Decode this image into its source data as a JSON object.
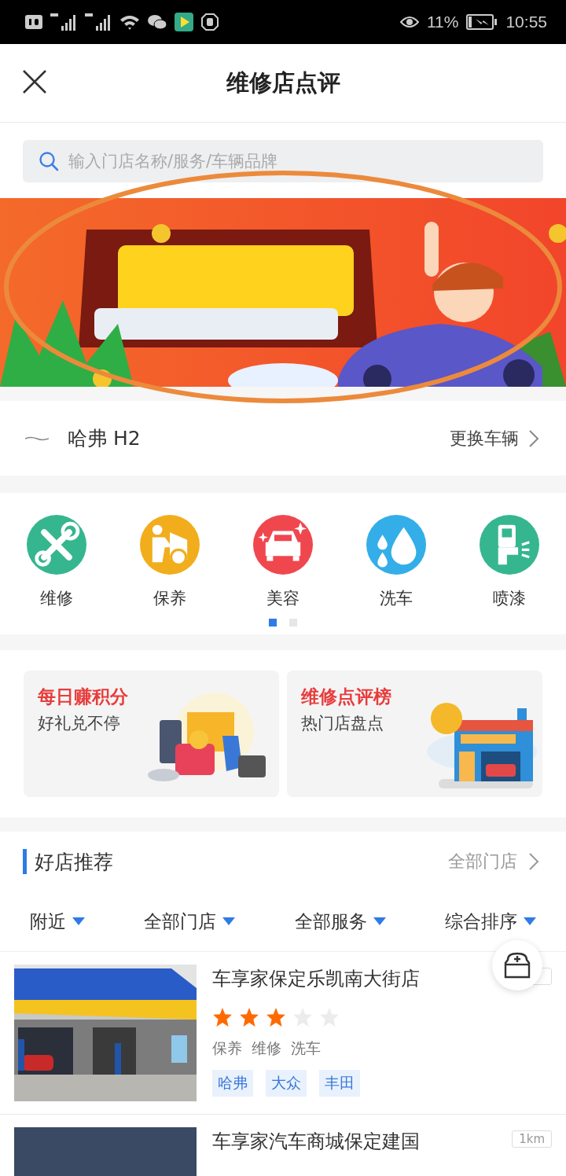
{
  "status_bar": {
    "battery": "11%",
    "time": "10:55"
  },
  "header": {
    "title": "维修店点评"
  },
  "search": {
    "placeholder": "输入门店名称/服务/车辆品牌"
  },
  "vehicle": {
    "name": "哈弗 H2",
    "action": "更换车辆"
  },
  "categories": [
    {
      "label": "维修",
      "color": "#35b68f"
    },
    {
      "label": "保养",
      "color": "#f2ad1c"
    },
    {
      "label": "美容",
      "color": "#f0474f"
    },
    {
      "label": "洗车",
      "color": "#34aee8"
    },
    {
      "label": "喷漆",
      "color": "#35b68f"
    }
  ],
  "pager": [
    {
      "selected": true
    },
    {
      "selected": false
    }
  ],
  "promos": [
    {
      "title": "每日赚积分",
      "subtitle": "好礼兑不停"
    },
    {
      "title": "维修点评榜",
      "subtitle": "热门店盘点"
    }
  ],
  "section": {
    "title": "好店推荐",
    "more": "全部门店"
  },
  "filters": [
    {
      "label": "附近"
    },
    {
      "label": "全部门店"
    },
    {
      "label": "全部服务"
    },
    {
      "label": "综合排序"
    }
  ],
  "shops": [
    {
      "name": "车享家保定乐凯南大街店",
      "stars": 3,
      "services": [
        "保养",
        "维修",
        "洗车"
      ],
      "brands": [
        "哈弗",
        "大众",
        "丰田"
      ]
    },
    {
      "name": "车享家汽车商城保定建国",
      "distance": "1km"
    }
  ]
}
